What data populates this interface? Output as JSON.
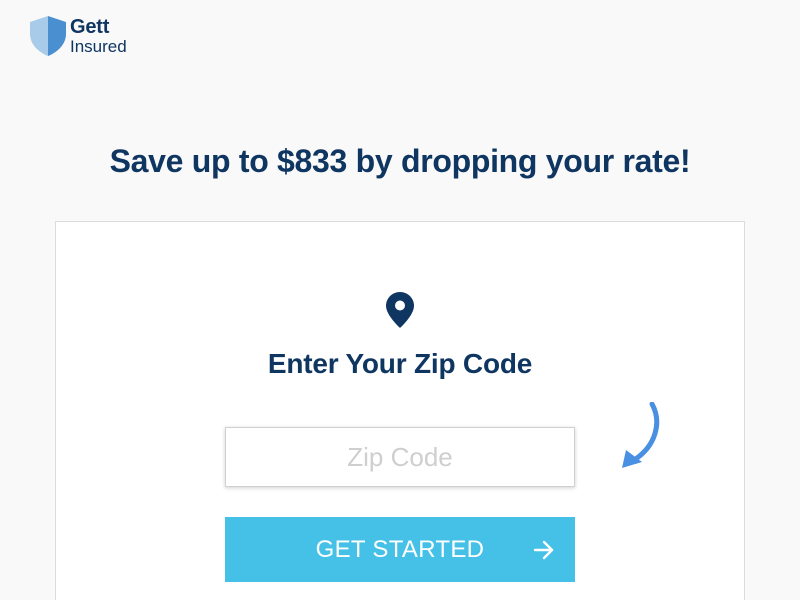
{
  "brand": {
    "line1": "Gett",
    "line2": "Insured",
    "shield_icon": "shield-icon",
    "colors": {
      "shield_light": "#9fc6e8",
      "shield_dark": "#4a90d0",
      "text": "#0f3561"
    }
  },
  "headline": "Save up to $833 by dropping your rate!",
  "card": {
    "icon": "map-pin-icon",
    "title": "Enter Your Zip Code",
    "zip_input": {
      "placeholder": "Zip Code",
      "value": ""
    },
    "hint_arrow_icon": "curved-arrow-down-left-icon",
    "cta": {
      "label": "GET STARTED",
      "icon": "arrow-right-icon"
    }
  },
  "colors": {
    "page_bg": "#f9f9f9",
    "primary_text": "#0f3561",
    "button_bg": "#45c0e6",
    "button_text": "#ffffff",
    "hint_arrow": "#4a90e2",
    "placeholder": "#cfcfcf"
  }
}
